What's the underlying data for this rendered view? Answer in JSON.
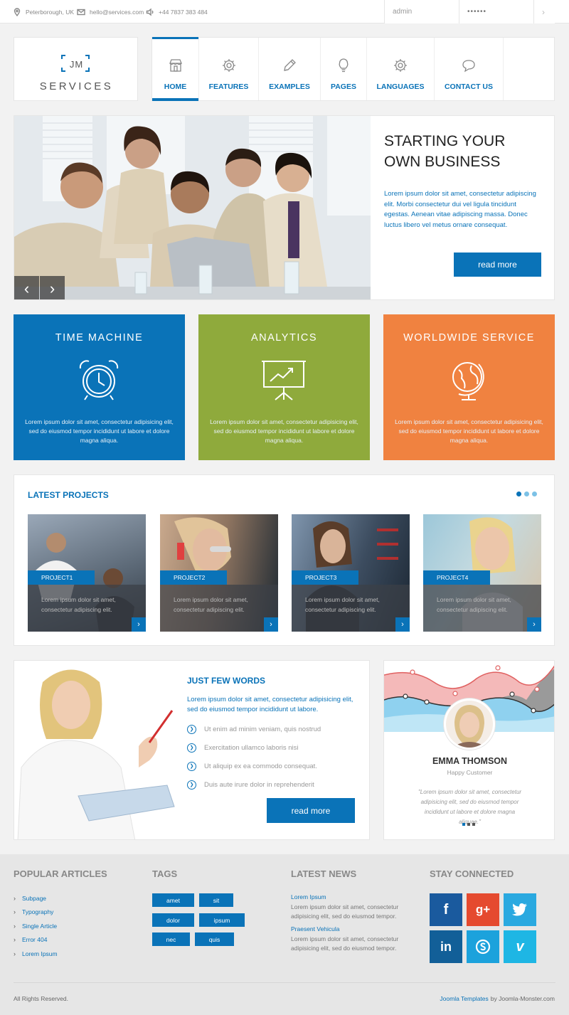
{
  "topbar": {
    "location": "Peterborough, UK",
    "email": "hello@services.com",
    "phone": "+44 7837 383 484",
    "username_value": "admin",
    "password_value": "••••••"
  },
  "logo": {
    "mark": "JM",
    "text": "SERVICES"
  },
  "nav": [
    {
      "label": "HOME",
      "icon": "shop-icon"
    },
    {
      "label": "FEATURES",
      "icon": "gear-icon"
    },
    {
      "label": "EXAMPLES",
      "icon": "pencil-icon"
    },
    {
      "label": "PAGES",
      "icon": "lightbulb-icon"
    },
    {
      "label": "LANGUAGES",
      "icon": "gear-icon"
    },
    {
      "label": "CONTACT US",
      "icon": "chat-bubble-icon"
    }
  ],
  "hero": {
    "title_line1": "STARTING YOUR",
    "title_line2": "OWN BUSINESS",
    "text": "Lorem ipsum dolor sit amet, consectetur adipiscing elit. Morbi consectetur dui vel ligula tincidunt egestas. Aenean vitae adipiscing massa. Donec luctus libero vel metus ornare consequat.",
    "button": "read more"
  },
  "features": [
    {
      "title": "TIME MACHINE",
      "icon": "alarm-clock-icon",
      "color": "#0a73b8",
      "text": "Lorem ipsum dolor sit amet, consectetur adipisicing elit, sed do eiusmod tempor incididunt ut labore et dolore magna aliqua."
    },
    {
      "title": "ANALYTICS",
      "icon": "presentation-chart-icon",
      "color": "#8faa3c",
      "text": "Lorem ipsum dolor sit amet, consectetur adipisicing elit, sed do eiusmod tempor incididunt ut labore et dolore magna aliqua."
    },
    {
      "title": "WORLDWIDE SERVICE",
      "icon": "globe-icon",
      "color": "#f08240",
      "text": "Lorem ipsum dolor sit amet, consectetur adipisicing elit, sed do eiusmod tempor incididunt ut labore et dolore magna aliqua."
    }
  ],
  "projects": {
    "heading": "LATEST PROJECTS",
    "items": [
      {
        "label": "PROJECT1",
        "text": "Lorem ipsum dolor sit amet, consectetur adipiscing elit."
      },
      {
        "label": "PROJECT2",
        "text": "Lorem ipsum dolor sit amet, consectetur adipiscing elit."
      },
      {
        "label": "PROJECT3",
        "text": "Lorem ipsum dolor sit amet, consectetur adipiscing elit."
      },
      {
        "label": "PROJECT4",
        "text": "Lorem ipsum dolor sit amet, consectetur adipiscing elit."
      }
    ]
  },
  "words": {
    "heading": "JUST FEW WORDS",
    "intro": "Lorem ipsum dolor sit amet, consectetur adipisicing elit, sed do eiusmod tempor incididunt ut labore.",
    "items": [
      "Ut enim ad minim veniam, quis nostrud",
      "Exercitation ullamco laboris nisi",
      "Ut aliquip ex ea commodo consequat.",
      "Duis aute irure dolor in reprehenderit"
    ],
    "button": "read more"
  },
  "testimonial": {
    "name": "EMMA THOMSON",
    "role": "Happy Customer",
    "quote": "\"Lorem ipsum dolor sit amet, consectetur adipisicing elit, sed do eiusmod tempor incididunt ut labore et dolore magna aliquae.\""
  },
  "footer": {
    "popular": {
      "heading": "POPULAR ARTICLES",
      "links": [
        "Subpage",
        "Typography",
        "Single Article",
        "Error 404",
        "Lorem Ipsum"
      ]
    },
    "tags": {
      "heading": "TAGS",
      "items": [
        "amet",
        "sit",
        "dolor",
        "ipsum",
        "nec",
        "quis"
      ]
    },
    "news": {
      "heading": "LATEST NEWS",
      "items": [
        {
          "title": "Lorem Ipsum",
          "text": "Lorem ipsum dolor sit amet, consectetur adipisicing elit, sed do eiusmod tempor."
        },
        {
          "title": "Praesent Vehicula",
          "text": "Lorem ipsum dolor sit amet, consectetur adipisicing elit, sed do eiusmod tempor."
        }
      ]
    },
    "social": {
      "heading": "STAY CONNECTED",
      "items": [
        {
          "icon": "facebook-icon",
          "glyph": "f",
          "color": "#1a5a9e"
        },
        {
          "icon": "google-plus-icon",
          "glyph": "g+",
          "color": "#e54a2f"
        },
        {
          "icon": "twitter-icon",
          "glyph": "t",
          "color": "#2aa9e0"
        },
        {
          "icon": "linkedin-icon",
          "glyph": "in",
          "color": "#125f98"
        },
        {
          "icon": "skype-icon",
          "glyph": "S",
          "color": "#1ca2dc"
        },
        {
          "icon": "vimeo-icon",
          "glyph": "v",
          "color": "#1eb6e4"
        }
      ]
    },
    "copyright": "All Rights Reserved.",
    "credit_link": "Joomla Templates",
    "credit_by": "by Joomla-Monster.com"
  }
}
